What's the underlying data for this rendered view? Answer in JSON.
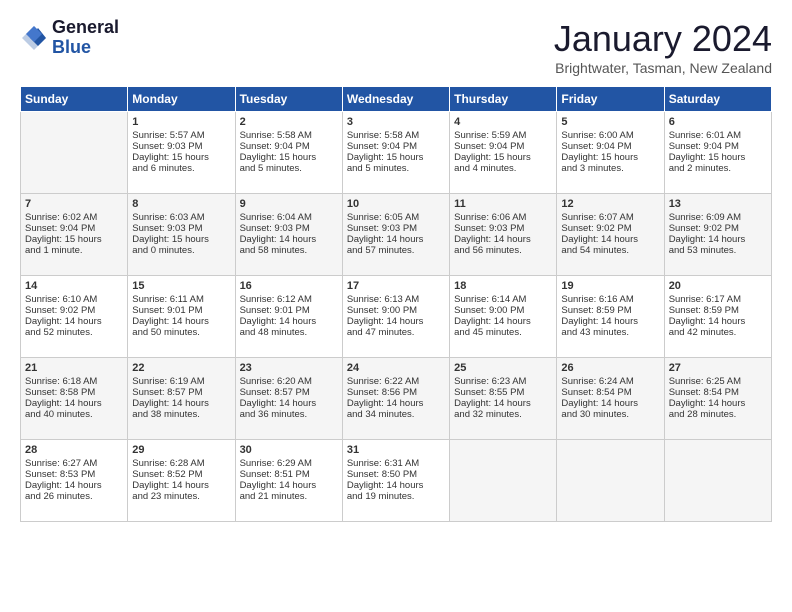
{
  "logo": {
    "general": "General",
    "blue": "Blue"
  },
  "title": "January 2024",
  "subtitle": "Brightwater, Tasman, New Zealand",
  "days_header": [
    "Sunday",
    "Monday",
    "Tuesday",
    "Wednesday",
    "Thursday",
    "Friday",
    "Saturday"
  ],
  "weeks": [
    [
      {
        "day": "",
        "content": ""
      },
      {
        "day": "1",
        "content": "Sunrise: 5:57 AM\nSunset: 9:03 PM\nDaylight: 15 hours\nand 6 minutes."
      },
      {
        "day": "2",
        "content": "Sunrise: 5:58 AM\nSunset: 9:04 PM\nDaylight: 15 hours\nand 5 minutes."
      },
      {
        "day": "3",
        "content": "Sunrise: 5:58 AM\nSunset: 9:04 PM\nDaylight: 15 hours\nand 5 minutes."
      },
      {
        "day": "4",
        "content": "Sunrise: 5:59 AM\nSunset: 9:04 PM\nDaylight: 15 hours\nand 4 minutes."
      },
      {
        "day": "5",
        "content": "Sunrise: 6:00 AM\nSunset: 9:04 PM\nDaylight: 15 hours\nand 3 minutes."
      },
      {
        "day": "6",
        "content": "Sunrise: 6:01 AM\nSunset: 9:04 PM\nDaylight: 15 hours\nand 2 minutes."
      }
    ],
    [
      {
        "day": "7",
        "content": "Sunrise: 6:02 AM\nSunset: 9:04 PM\nDaylight: 15 hours\nand 1 minute."
      },
      {
        "day": "8",
        "content": "Sunrise: 6:03 AM\nSunset: 9:03 PM\nDaylight: 15 hours\nand 0 minutes."
      },
      {
        "day": "9",
        "content": "Sunrise: 6:04 AM\nSunset: 9:03 PM\nDaylight: 14 hours\nand 58 minutes."
      },
      {
        "day": "10",
        "content": "Sunrise: 6:05 AM\nSunset: 9:03 PM\nDaylight: 14 hours\nand 57 minutes."
      },
      {
        "day": "11",
        "content": "Sunrise: 6:06 AM\nSunset: 9:03 PM\nDaylight: 14 hours\nand 56 minutes."
      },
      {
        "day": "12",
        "content": "Sunrise: 6:07 AM\nSunset: 9:02 PM\nDaylight: 14 hours\nand 54 minutes."
      },
      {
        "day": "13",
        "content": "Sunrise: 6:09 AM\nSunset: 9:02 PM\nDaylight: 14 hours\nand 53 minutes."
      }
    ],
    [
      {
        "day": "14",
        "content": "Sunrise: 6:10 AM\nSunset: 9:02 PM\nDaylight: 14 hours\nand 52 minutes."
      },
      {
        "day": "15",
        "content": "Sunrise: 6:11 AM\nSunset: 9:01 PM\nDaylight: 14 hours\nand 50 minutes."
      },
      {
        "day": "16",
        "content": "Sunrise: 6:12 AM\nSunset: 9:01 PM\nDaylight: 14 hours\nand 48 minutes."
      },
      {
        "day": "17",
        "content": "Sunrise: 6:13 AM\nSunset: 9:00 PM\nDaylight: 14 hours\nand 47 minutes."
      },
      {
        "day": "18",
        "content": "Sunrise: 6:14 AM\nSunset: 9:00 PM\nDaylight: 14 hours\nand 45 minutes."
      },
      {
        "day": "19",
        "content": "Sunrise: 6:16 AM\nSunset: 8:59 PM\nDaylight: 14 hours\nand 43 minutes."
      },
      {
        "day": "20",
        "content": "Sunrise: 6:17 AM\nSunset: 8:59 PM\nDaylight: 14 hours\nand 42 minutes."
      }
    ],
    [
      {
        "day": "21",
        "content": "Sunrise: 6:18 AM\nSunset: 8:58 PM\nDaylight: 14 hours\nand 40 minutes."
      },
      {
        "day": "22",
        "content": "Sunrise: 6:19 AM\nSunset: 8:57 PM\nDaylight: 14 hours\nand 38 minutes."
      },
      {
        "day": "23",
        "content": "Sunrise: 6:20 AM\nSunset: 8:57 PM\nDaylight: 14 hours\nand 36 minutes."
      },
      {
        "day": "24",
        "content": "Sunrise: 6:22 AM\nSunset: 8:56 PM\nDaylight: 14 hours\nand 34 minutes."
      },
      {
        "day": "25",
        "content": "Sunrise: 6:23 AM\nSunset: 8:55 PM\nDaylight: 14 hours\nand 32 minutes."
      },
      {
        "day": "26",
        "content": "Sunrise: 6:24 AM\nSunset: 8:54 PM\nDaylight: 14 hours\nand 30 minutes."
      },
      {
        "day": "27",
        "content": "Sunrise: 6:25 AM\nSunset: 8:54 PM\nDaylight: 14 hours\nand 28 minutes."
      }
    ],
    [
      {
        "day": "28",
        "content": "Sunrise: 6:27 AM\nSunset: 8:53 PM\nDaylight: 14 hours\nand 26 minutes."
      },
      {
        "day": "29",
        "content": "Sunrise: 6:28 AM\nSunset: 8:52 PM\nDaylight: 14 hours\nand 23 minutes."
      },
      {
        "day": "30",
        "content": "Sunrise: 6:29 AM\nSunset: 8:51 PM\nDaylight: 14 hours\nand 21 minutes."
      },
      {
        "day": "31",
        "content": "Sunrise: 6:31 AM\nSunset: 8:50 PM\nDaylight: 14 hours\nand 19 minutes."
      },
      {
        "day": "",
        "content": ""
      },
      {
        "day": "",
        "content": ""
      },
      {
        "day": "",
        "content": ""
      }
    ]
  ]
}
